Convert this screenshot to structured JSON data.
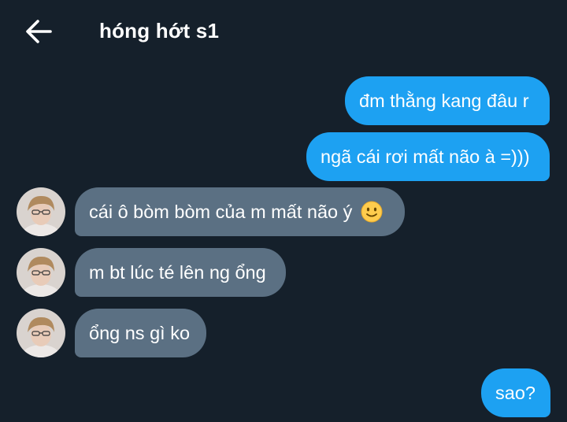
{
  "header": {
    "title": "hóng hớt s1",
    "back_icon": "arrow-left-icon"
  },
  "messages": [
    {
      "direction": "outgoing",
      "text": "đm thằng kang đâu r"
    },
    {
      "direction": "outgoing",
      "text": "ngã cái rơi mất não à =)))"
    },
    {
      "direction": "incoming",
      "text": "cái ô bòm bòm của m mất não ý",
      "emoji": "slightly-smiling-face-icon"
    },
    {
      "direction": "incoming",
      "text": "m bt lúc té lên ng ổng"
    },
    {
      "direction": "incoming",
      "text": "ổng ns gì ko"
    },
    {
      "direction": "outgoing",
      "text": "sao?"
    }
  ],
  "colors": {
    "background": "#15202b",
    "outgoing_bubble": "#1da1f2",
    "incoming_bubble": "#5b7083",
    "text": "#ffffff"
  }
}
